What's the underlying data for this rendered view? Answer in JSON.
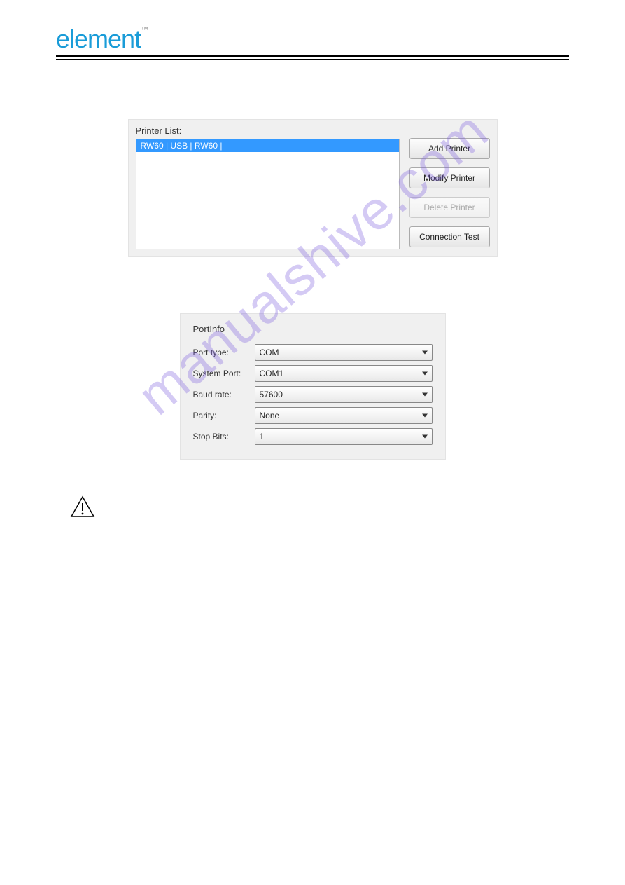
{
  "logo": {
    "text": "element",
    "tm": "™"
  },
  "watermark": "manualshive.com",
  "printer_panel": {
    "list_label": "Printer List:",
    "items": [
      "RW60 | USB | RW60 |"
    ],
    "buttons": {
      "add": "Add Printer",
      "modify": "Modify Printer",
      "delete": "Delete Printer",
      "test": "Connection Test"
    }
  },
  "port_panel": {
    "title": "PortInfo",
    "rows": {
      "port_type": {
        "label": "Port type:",
        "value": "COM"
      },
      "system_port": {
        "label": "System Port:",
        "value": "COM1"
      },
      "baud_rate": {
        "label": "Baud rate:",
        "value": "57600"
      },
      "parity": {
        "label": "Parity:",
        "value": "None"
      },
      "stop_bits": {
        "label": "Stop Bits:",
        "value": "1"
      }
    }
  }
}
